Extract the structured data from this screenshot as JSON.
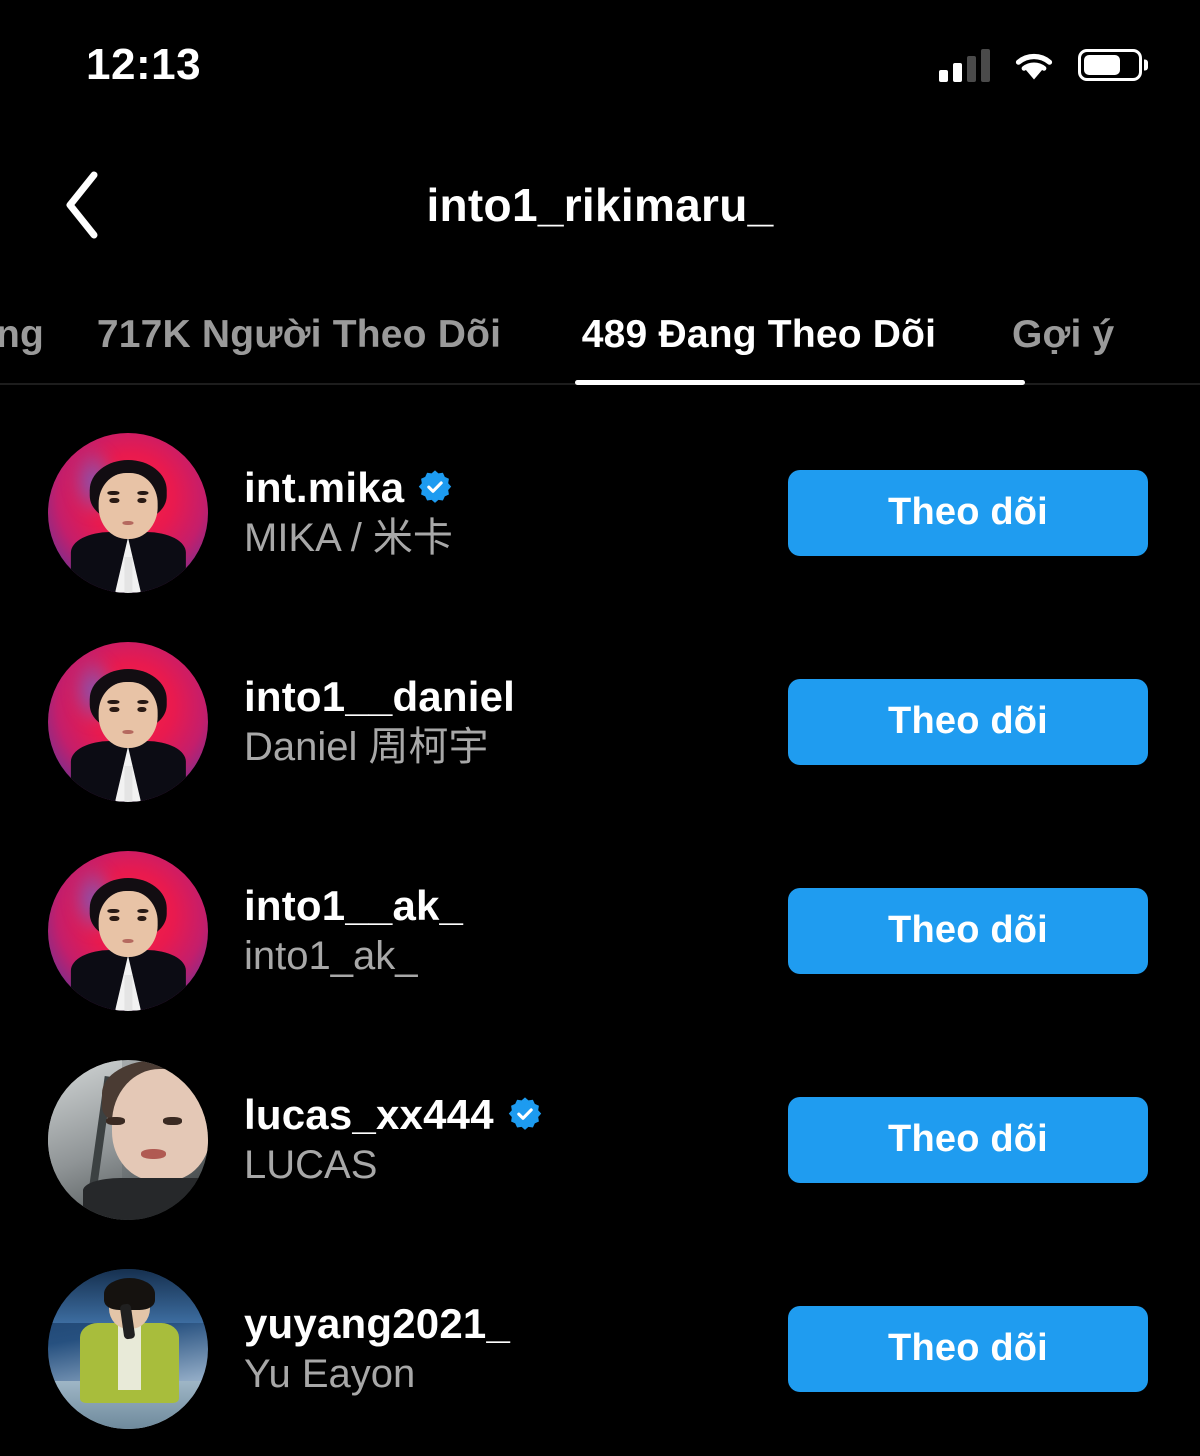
{
  "status_bar": {
    "time": "12:13",
    "cellular_icon": "cellular-signal-icon",
    "cellular_bars_filled": 2,
    "cellular_bars_total": 4,
    "wifi_icon": "wifi-icon",
    "battery_icon": "battery-icon",
    "battery_level_percent": 70
  },
  "nav": {
    "back_icon": "chevron-left-icon",
    "title": "into1_rikimaru_"
  },
  "tabs": [
    {
      "label": "ung",
      "active": false
    },
    {
      "label": "717K Người Theo Dõi",
      "active": false
    },
    {
      "label": "489 Đang Theo Dõi",
      "active": true
    },
    {
      "label": "Gợi ý",
      "active": false
    }
  ],
  "colors": {
    "background": "#000000",
    "accent_blue": "#1d9bf0",
    "button_blue": "#1f9cf0",
    "verified_blue": "#1d9bf0",
    "active_tab_text": "#ffffff",
    "inactive_tab_text": "#9a9a9a",
    "secondary_text": "#a8a8a8"
  },
  "list": {
    "follow_button_label": "Theo dõi",
    "verified_badge_icon": "verified-badge-icon",
    "rows": [
      {
        "username": "int.mika",
        "fullname": "MIKA / 米卡",
        "verified": true,
        "avatar": "avatar-int-mika",
        "button_label": "Theo dõi"
      },
      {
        "username": "into1__daniel",
        "fullname": "Daniel 周柯宇",
        "verified": false,
        "avatar": "avatar-into1-daniel",
        "button_label": "Theo dõi"
      },
      {
        "username": "into1__ak_",
        "fullname": "into1_ak_",
        "verified": false,
        "avatar": "avatar-into1-ak",
        "button_label": "Theo dõi"
      },
      {
        "username": "lucas_xx444",
        "fullname": "LUCAS",
        "verified": true,
        "avatar": "avatar-lucas",
        "button_label": "Theo dõi"
      },
      {
        "username": "yuyang2021_",
        "fullname": "Yu Eayon",
        "verified": false,
        "avatar": "avatar-yuyang",
        "button_label": "Theo dõi"
      }
    ]
  }
}
